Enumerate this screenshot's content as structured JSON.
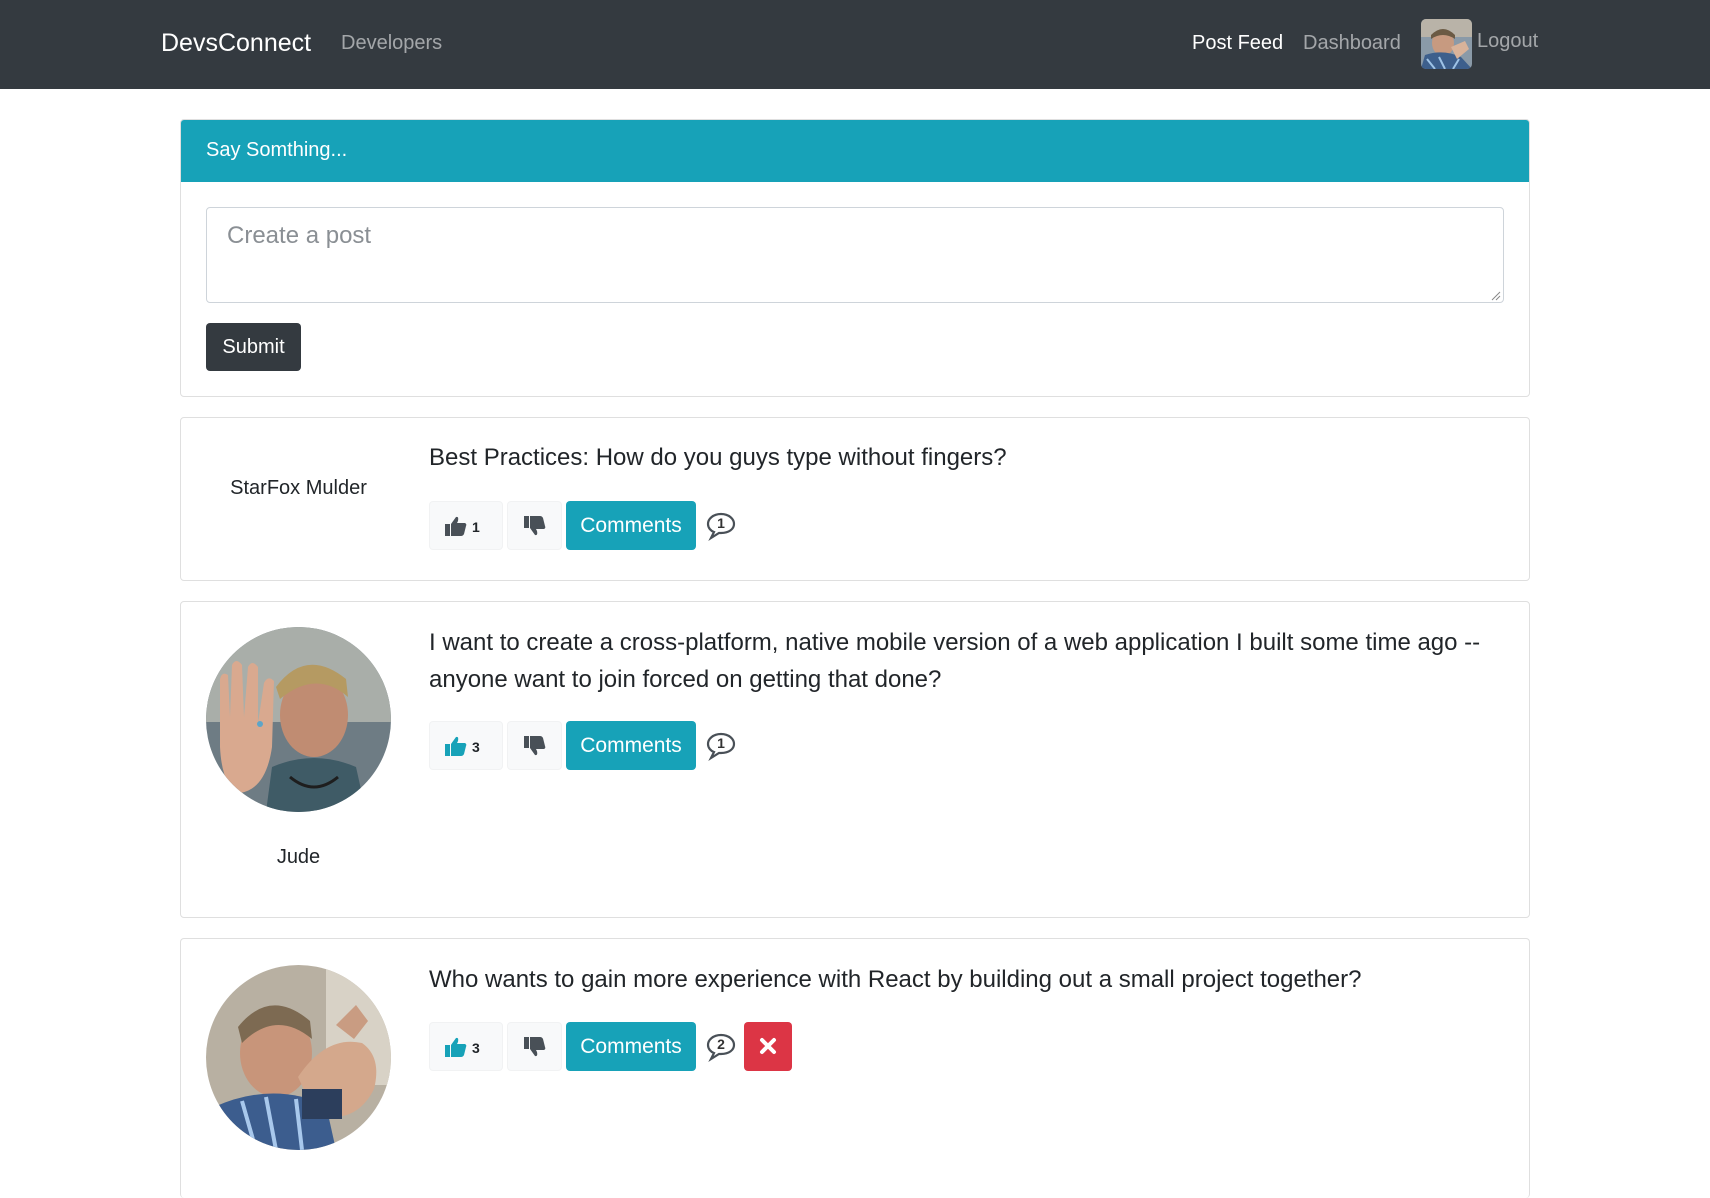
{
  "navbar": {
    "brand": "DevsConnect",
    "developers": "Developers",
    "post_feed": "Post Feed",
    "dashboard": "Dashboard",
    "logout": "Logout"
  },
  "post_form": {
    "header": "Say Somthing...",
    "placeholder": "Create a post",
    "submit_label": "Submit"
  },
  "posts": [
    {
      "author": "StarFox Mulder",
      "text": "Best Practices: How do you guys type without fingers?",
      "likes": "1",
      "liked": false,
      "comments_label": "Comments",
      "comment_count": "1"
    },
    {
      "author": "Jude",
      "text": "I want to create a cross-platform, native mobile version of a web application I built some time ago -- anyone want to join forced on getting that done?",
      "likes": "3",
      "liked": true,
      "comments_label": "Comments",
      "comment_count": "1"
    },
    {
      "author": "",
      "text": "Who wants to gain more experience with React by building out a small project together?",
      "likes": "3",
      "liked": true,
      "comments_label": "Comments",
      "comment_count": "2",
      "deletable": true
    }
  ],
  "colors": {
    "navbar_bg": "#343a40",
    "info": "#17a2b8",
    "danger": "#dc3545",
    "liked_icon": "#17a2b8",
    "unliked_icon": "#495057"
  },
  "icons": {
    "like": "thumbs-up-icon",
    "unlike": "thumbs-down-icon",
    "comments": "comment-bubble-icon",
    "delete": "close-icon"
  }
}
